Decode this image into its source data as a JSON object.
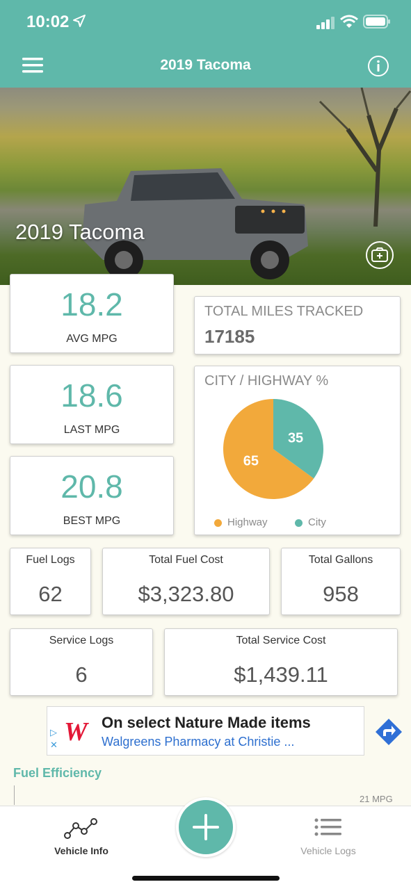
{
  "status": {
    "time": "10:02"
  },
  "nav": {
    "title": "2019 Tacoma"
  },
  "hero": {
    "title": "2019 Tacoma"
  },
  "mpg": [
    {
      "value": "18.2",
      "label": "AVG MPG"
    },
    {
      "value": "18.6",
      "label": "LAST MPG"
    },
    {
      "value": "20.8",
      "label": "BEST MPG"
    }
  ],
  "miles": {
    "label": "TOTAL MILES TRACKED",
    "value": "17185"
  },
  "split": {
    "label": "CITY / HIGHWAY %",
    "highway": {
      "name": "Highway",
      "value": 65,
      "color": "#f2a93b"
    },
    "city": {
      "name": "City",
      "value": 35,
      "color": "#5fb8aa"
    }
  },
  "stats": {
    "fuel_logs": {
      "label": "Fuel Logs",
      "value": "62"
    },
    "fuel_cost": {
      "label": "Total Fuel Cost",
      "value": "$3,323.80"
    },
    "gallons": {
      "label": "Total Gallons",
      "value": "958"
    },
    "service_logs": {
      "label": "Service Logs",
      "value": "6"
    },
    "service_cost": {
      "label": "Total Service Cost",
      "value": "$1,439.11"
    }
  },
  "ad": {
    "headline": "On select Nature Made items",
    "subline": "Walgreens Pharmacy at Christie ...",
    "logo": "W"
  },
  "fuel_efficiency": {
    "title": "Fuel Efficiency",
    "tick": "21 MPG"
  },
  "tabs": {
    "vehicle_info": "Vehicle Info",
    "vehicle_logs": "Vehicle Logs"
  },
  "colors": {
    "accent": "#5fb8aa",
    "highway": "#f2a93b"
  }
}
